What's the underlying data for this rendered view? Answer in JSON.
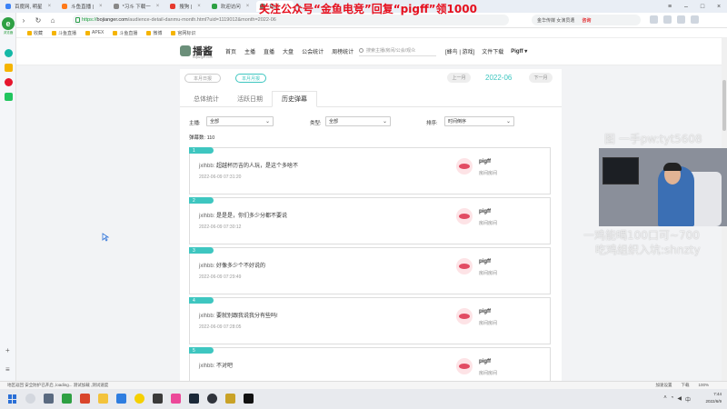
{
  "browser": {
    "tabs": [
      {
        "label": "百度网, 明星",
        "color": "#3b82f6",
        "active": false
      },
      {
        "label": "斗鱼直播 |",
        "color": "#ff7a1a",
        "active": false
      },
      {
        "label": "*习斗 下载一",
        "color": "#888888",
        "active": false
      },
      {
        "label": "搜狗 |",
        "color": "#e63a2e",
        "active": false
      },
      {
        "label": "欢迎访问",
        "color": "#2ea043",
        "active": false
      },
      {
        "label": "播道",
        "color": "#6b8f7a",
        "active": true
      }
    ],
    "url_scheme": "https://",
    "url_domain": "bojianger.com",
    "url_path": "/audience-detail-danmu-month.html?uid=1119012&month=2022-06",
    "search_placeholder": "金华传媒 女演员遭",
    "search_hot": "咨询",
    "bookmarks": [
      "收藏",
      "斗鱼直播",
      "APEX",
      "斗鱼直播",
      "微博",
      "官网标识"
    ]
  },
  "overlay_banner": "关注公众号“金鱼电竞”回复“pigff”领1000",
  "sidebar": {
    "logo": "e",
    "logo_text": "浏览器"
  },
  "site": {
    "logo_name": "播酱",
    "logo_sub": "bojianger.com",
    "nav": [
      "首页",
      "主播",
      "直播",
      "大盘",
      "公会统计",
      "周榜统计"
    ],
    "search_placeholder": "搜索主播/房间/公会/观众",
    "header_links": [
      "[蜂鸟 | 游戏]",
      "文件下载"
    ],
    "user": "Pigff"
  },
  "card": {
    "mode_pills": [
      "本月日报",
      "本月月报"
    ],
    "prev_month": "上一月",
    "next_month": "下一月",
    "month": "2022-06",
    "tabs": [
      "总体统计",
      "活跃日期",
      "历史弹幕"
    ],
    "filters": {
      "anchor_label": "主播:",
      "anchor_value": "全部",
      "type_label": "类型:",
      "type_value": "全部",
      "sort_label": "排序:",
      "sort_value": "时间倒序"
    },
    "total_label": "弹幕数:",
    "total_value": "110"
  },
  "danmaku": [
    {
      "num": "1",
      "sender": "jxlhbb:",
      "text": "超越杯历吉的人玩，是这个多啥不",
      "time": "2022-06-09 07:31:20",
      "user": "pigff",
      "room": "房间房间"
    },
    {
      "num": "2",
      "sender": "jxlhbb:",
      "text": "是是是，你们多少分都不要说",
      "time": "2022-06-09 07:30:12",
      "user": "pigff",
      "room": "房间房间"
    },
    {
      "num": "3",
      "sender": "jxlhbb:",
      "text": "好像多少个不好说的",
      "time": "2022-06-09 07:29:49",
      "user": "pigff",
      "room": "房间房间"
    },
    {
      "num": "4",
      "sender": "jxlhbb:",
      "text": "要就别跟我说我分有些吗!",
      "time": "2022-06-09 07:28:05",
      "user": "pigff",
      "room": "房间房间"
    },
    {
      "num": "5",
      "sender": "jxlhbb:",
      "text": "不对吧",
      "time": "",
      "user": "pigff",
      "room": "房间房间"
    }
  ],
  "ghost_text": {
    "line1": "图 一手pw:tyt5608",
    "line2": "一鸡能喝100口可~700",
    "line3": "吃鸡组织入坑:shnzty"
  },
  "status": {
    "left": "地区返回 安全防护已开启 ,loading... 测试加载 ,测试速度",
    "right": [
      "加速设置",
      "下载",
      "100%"
    ]
  },
  "tray": {
    "time": "7:44",
    "date": "2022/6/9"
  }
}
